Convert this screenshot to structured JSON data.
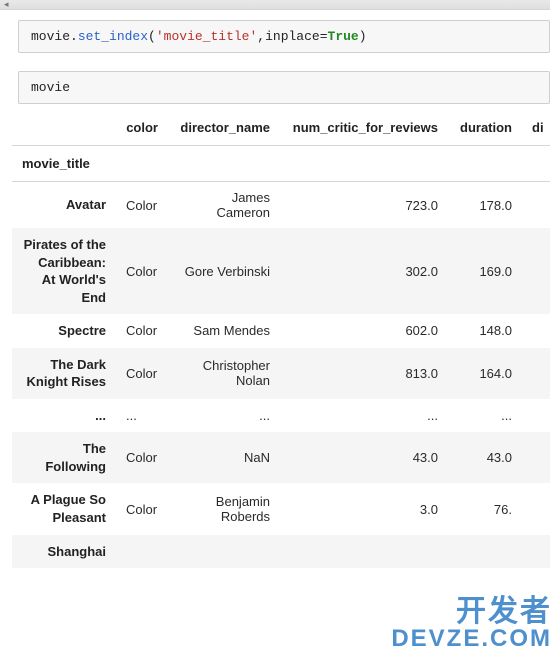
{
  "cells": {
    "set_index": {
      "obj": "movie",
      "method": "set_index",
      "arg_str": "'movie_title'",
      "kw_param": "inplace",
      "kw_value": "True"
    },
    "show": {
      "expr": "movie"
    }
  },
  "table": {
    "columns": [
      "color",
      "director_name",
      "num_critic_for_reviews",
      "duration"
    ],
    "extra_col_fragment": "di",
    "index_name": "movie_title",
    "rows": [
      {
        "idx": "Avatar",
        "color": "Color",
        "director": "James Cameron",
        "critic": "723.0",
        "duration": "178.0"
      },
      {
        "idx": "Pirates of the Caribbean: At World's End",
        "color": "Color",
        "director": "Gore Verbinski",
        "critic": "302.0",
        "duration": "169.0"
      },
      {
        "idx": "Spectre",
        "color": "Color",
        "director": "Sam Mendes",
        "critic": "602.0",
        "duration": "148.0"
      },
      {
        "idx": "The Dark Knight Rises",
        "color": "Color",
        "director": "Christopher Nolan",
        "critic": "813.0",
        "duration": "164.0"
      },
      {
        "idx": "...",
        "color": "...",
        "director": "...",
        "critic": "...",
        "duration": "..."
      },
      {
        "idx": "The Following",
        "color": "Color",
        "director": "NaN",
        "critic": "43.0",
        "duration": "43.0"
      },
      {
        "idx": "A Plague So Pleasant",
        "color": "Color",
        "director": "Benjamin Roberds",
        "critic": "3.0",
        "duration": "76."
      },
      {
        "idx": "Shanghai",
        "color": "",
        "director": "",
        "critic": "",
        "duration": ""
      }
    ]
  },
  "watermark": {
    "cn": "开发者",
    "en": "DEVZE.COM"
  }
}
